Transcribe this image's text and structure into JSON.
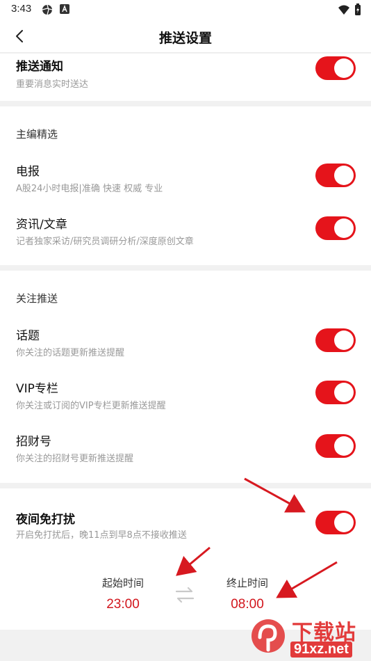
{
  "status_bar": {
    "time": "3:43",
    "icons": [
      "shutter-icon",
      "a-notification-icon",
      "wifi-icon",
      "battery-charging-icon"
    ]
  },
  "header": {
    "title": "推送设置",
    "back_icon": "chevron-left-icon"
  },
  "push": {
    "title": "推送通知",
    "subtitle": "重要消息实时送达",
    "on": true
  },
  "editor": {
    "header": "主编精选",
    "items": [
      {
        "title": "电报",
        "subtitle": "A股24小时电报|准确 快速 权威 专业",
        "on": true
      },
      {
        "title": "资讯/文章",
        "subtitle": "记者独家采访/研究员调研分析/深度原创文章",
        "on": true
      }
    ]
  },
  "follow": {
    "header": "关注推送",
    "items": [
      {
        "title": "话题",
        "subtitle": "你关注的话题更新推送提醒",
        "on": true
      },
      {
        "title": "VIP专栏",
        "subtitle": "你关注或订阅的VIP专栏更新推送提醒",
        "on": true
      },
      {
        "title": "招财号",
        "subtitle": "你关注的招财号更新推送提醒",
        "on": true
      }
    ]
  },
  "dnd": {
    "title": "夜间免打扰",
    "subtitle": "开启免打扰后，晚11点到早8点不接收推送",
    "on": true,
    "start_label": "起始时间",
    "start_time": "23:00",
    "end_label": "终止时间",
    "end_time": "08:00",
    "swap_icon": "swap-arrows-icon"
  },
  "watermark": {
    "text": "下载站",
    "domain": "91xz.net"
  },
  "colors": {
    "accent": "#e5141b",
    "time_red": "#d2151c",
    "annotation_arrow": "#d71920"
  }
}
